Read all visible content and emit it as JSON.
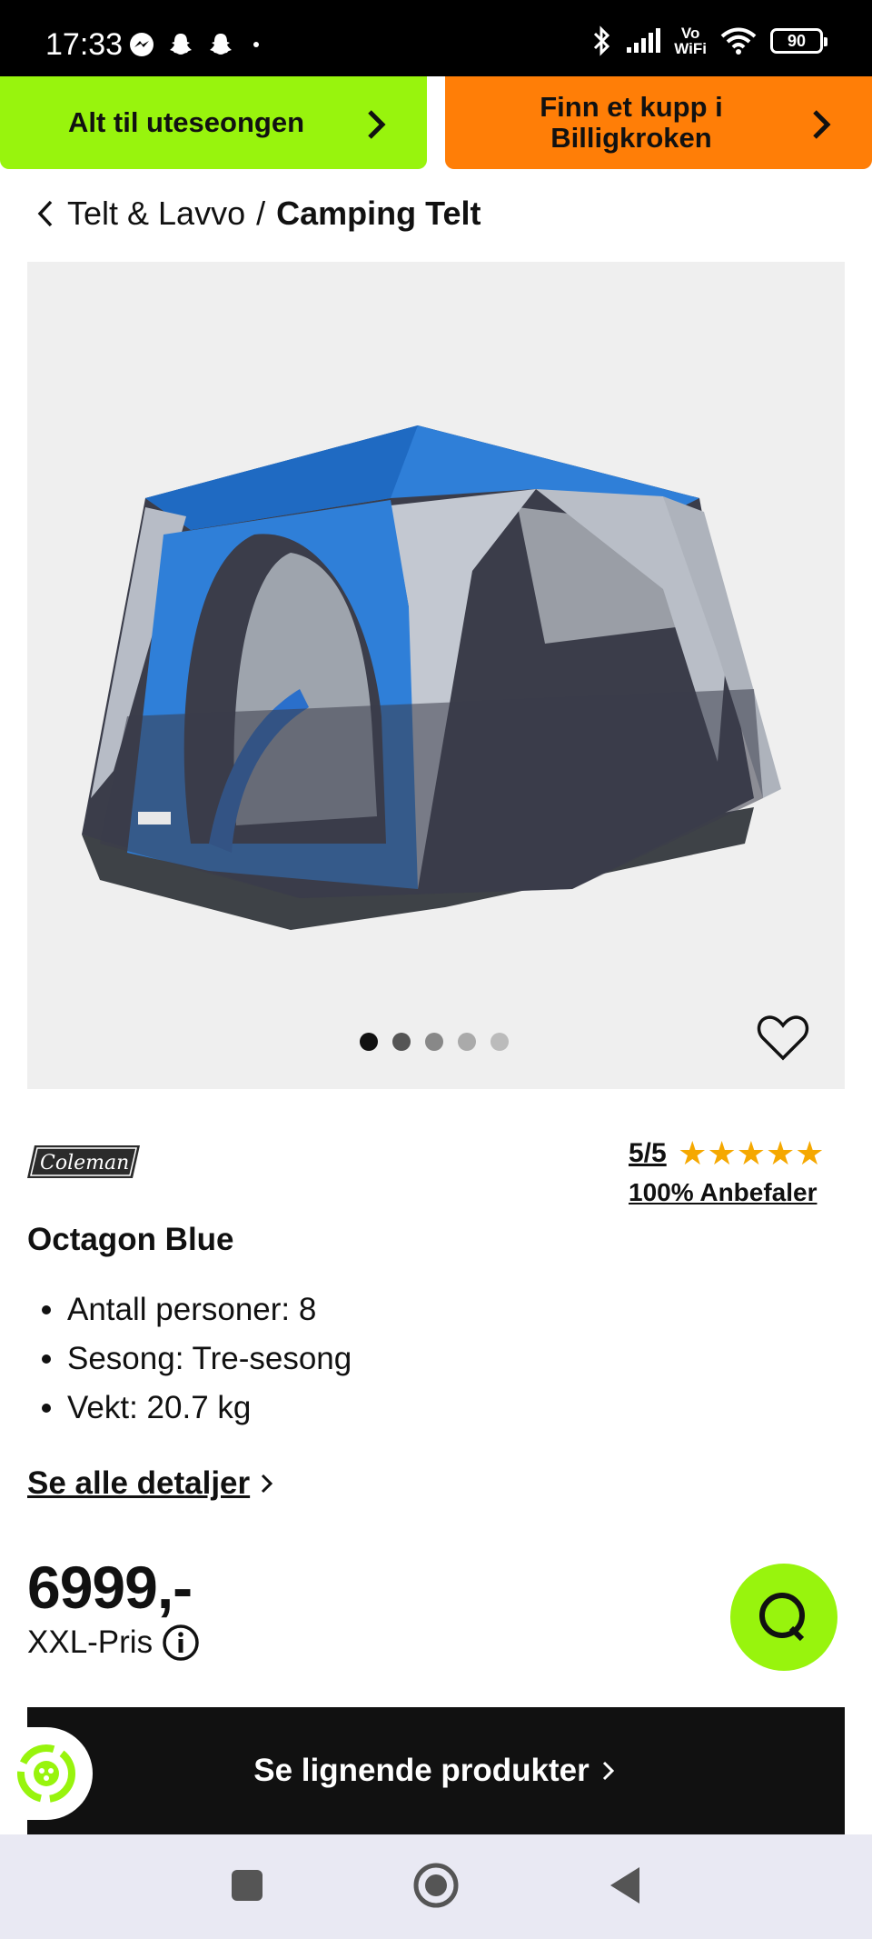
{
  "status_bar": {
    "time": "17:33",
    "battery": "90",
    "vowifi_line1": "Vo",
    "vowifi_line2": "WiFi"
  },
  "promos": {
    "left_label": "Alt til uteseongen",
    "right_label": "Finn et kupp i Billigkroken"
  },
  "breadcrumb": {
    "parent": "Telt & Lavvo",
    "separator": "/",
    "current": "Camping Telt"
  },
  "gallery": {
    "dot_count": 5,
    "active_dot": 0
  },
  "product": {
    "brand": "Coleman",
    "rating": "5/5",
    "stars": "★★★★★",
    "recommend": "100% Anbefaler",
    "title": "Octagon Blue",
    "specs": [
      "Antall personer: 8",
      "Sesong: Tre-sesong",
      "Vekt: 20.7 kg"
    ],
    "details_link": "Se alle detaljer",
    "price": "6999,-",
    "price_label": "XXL-Pris"
  },
  "similar_button": "Se lignende produkter",
  "colors": {
    "promo_green": "#98f40d",
    "promo_orange": "#ff7e07",
    "star": "#f5a800",
    "tent_blue": "#2f7fd8"
  }
}
